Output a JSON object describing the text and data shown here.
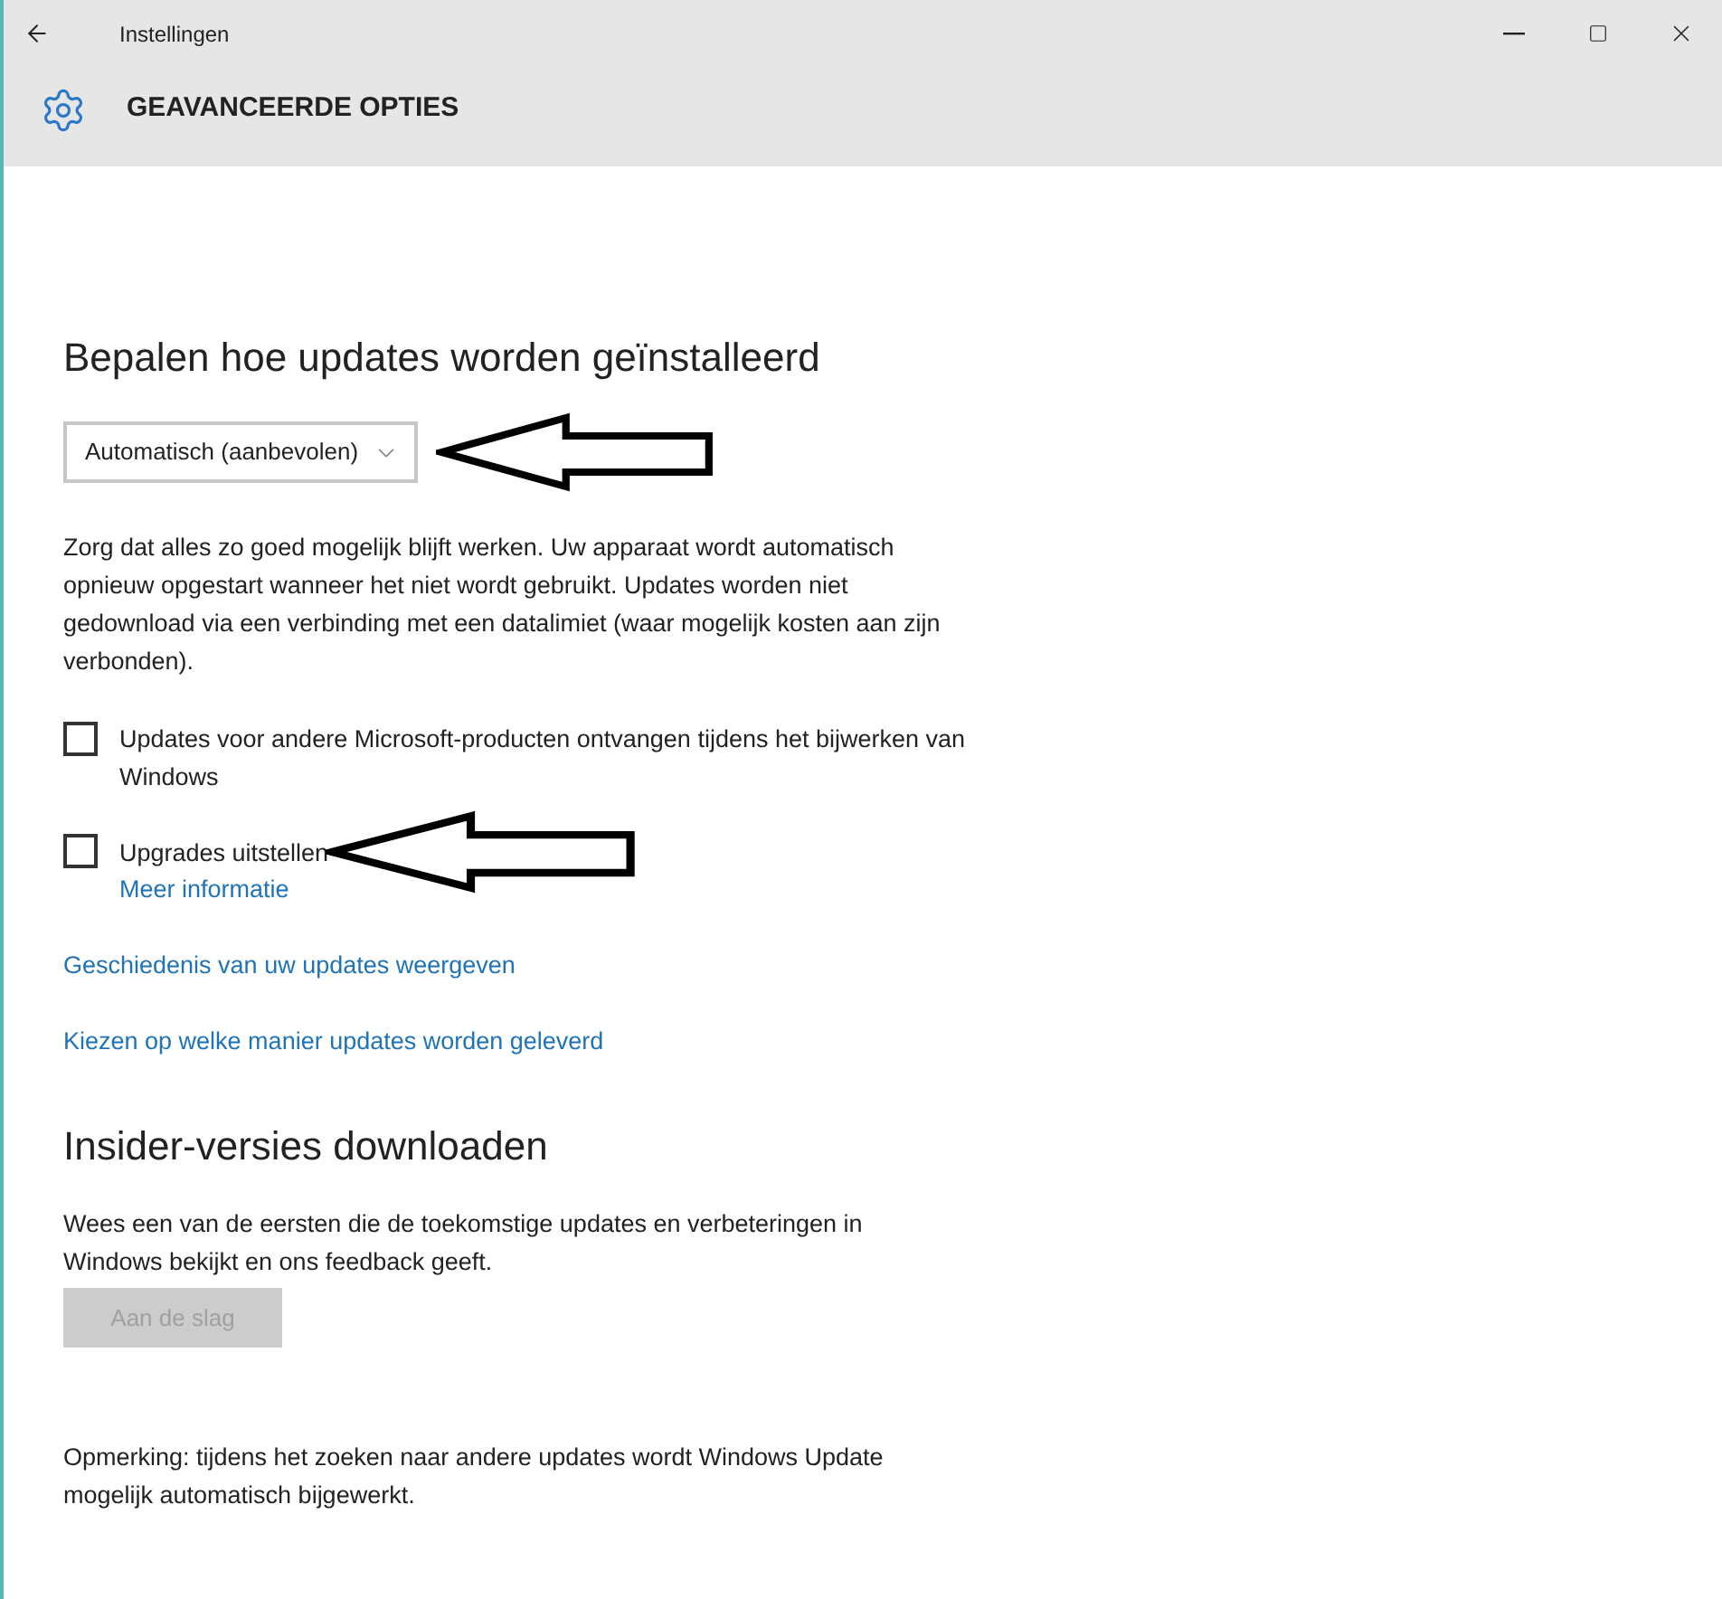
{
  "window": {
    "title": "Instellingen"
  },
  "header": {
    "title": "GEAVANCEERDE OPTIES"
  },
  "install_section": {
    "heading": "Bepalen hoe updates worden geïnstalleerd",
    "dropdown": {
      "value": "Automatisch (aanbevolen)"
    },
    "description": "Zorg dat alles zo goed mogelijk blijft werken. Uw apparaat wordt automatisch opnieuw opgestart wanneer het niet wordt gebruikt. Updates worden niet gedownload via een verbinding met een datalimiet (waar mogelijk kosten aan zijn verbonden).",
    "options": [
      {
        "label": "Updates voor andere Microsoft-producten ontvangen tijdens het bijwerken van Windows",
        "checked": false,
        "annotated": false
      },
      {
        "label": "Upgrades uitstellen",
        "checked": false,
        "annotated": true,
        "link": "Meer informatie"
      }
    ],
    "links": [
      "Geschiedenis van uw updates weergeven",
      "Kiezen op welke manier updates worden geleverd"
    ]
  },
  "insider_section": {
    "heading": "Insider-versies downloaden",
    "description": "Wees een van de eersten die de toekomstige updates en verbeteringen in Windows bekijkt en ons feedback geeft.",
    "button": {
      "label": "Aan de slag",
      "disabled": true
    }
  },
  "note": "Opmerking: tijdens het zoeken naar andere updates wordt Windows Update mogelijk automatisch bijgewerkt."
}
